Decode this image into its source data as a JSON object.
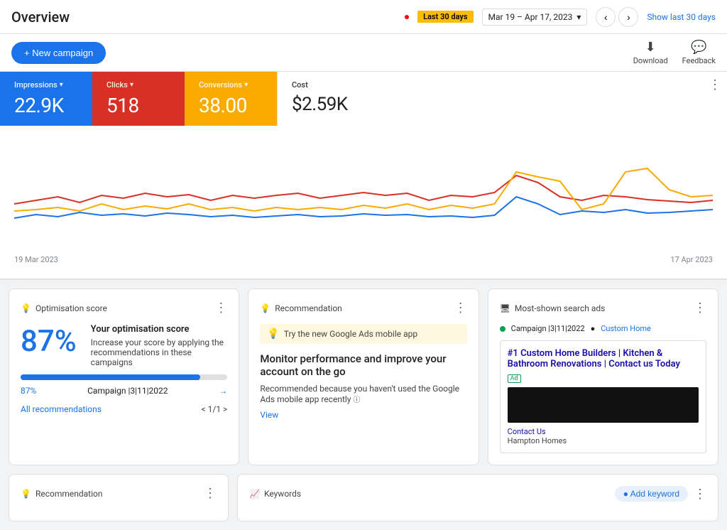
{
  "header": {
    "title": "Overview",
    "date_badge": "Last 30 days",
    "date_range": "Mar 19 – Apr 17, 2023",
    "show_last": "Show last 30 days",
    "nav_prev": "‹",
    "nav_next": "›"
  },
  "toolbar": {
    "new_campaign_label": "+ New campaign",
    "download_label": "Download",
    "feedback_label": "Feedback",
    "download_icon": "⬇",
    "feedback_icon": "💬"
  },
  "metrics": {
    "more_icon": "⋮",
    "cards": [
      {
        "id": "impressions",
        "label": "Impressions",
        "value": "22.9K",
        "color": "blue"
      },
      {
        "id": "clicks",
        "label": "Clicks",
        "value": "518",
        "color": "red"
      },
      {
        "id": "conversions",
        "label": "Conversions",
        "value": "38.00",
        "color": "amber"
      },
      {
        "id": "cost",
        "label": "Cost",
        "value": "$2.59K",
        "color": "white"
      }
    ]
  },
  "chart": {
    "date_start": "19 Mar 2023",
    "date_end": "17 Apr 2023"
  },
  "optimisation": {
    "panel_title": "Optimisation score",
    "score_pct": "87%",
    "score_bar_pct": 87,
    "heading": "Your optimisation score",
    "description": "Increase your score by applying the recommendations in these campaigns",
    "campaign_score": "87%",
    "campaign_name": "Campaign |3|11|2022",
    "all_recs_label": "All recommendations",
    "pagination": "< 1/1 >"
  },
  "recommendation": {
    "panel_title": "Recommendation",
    "tip_text": "Try the new Google Ads mobile app",
    "main_title": "Monitor performance and improve your account on the go",
    "body_text": "Recommended because you haven't used the Google Ads mobile app recently",
    "view_label": "View"
  },
  "most_shown_ads": {
    "panel_title": "Most-shown search ads",
    "campaign_label": "Campaign |3|11|2022",
    "custom_home_label": "Custom Home",
    "ad_title": "#1 Custom Home Builders | Kitchen & Bathroom Renovations | Contact us Today",
    "ad_badge": "Ad",
    "contact_us": "Contact Us",
    "company": "Hampton Homes"
  },
  "bottom_panels": {
    "recommendation_label": "Recommendation",
    "keywords_label": "Keywords",
    "add_keyword_label": "● Add keyword"
  },
  "icons": {
    "lightbulb": "💡",
    "monitor": "🖥",
    "trend": "📈",
    "more": "⋮"
  }
}
